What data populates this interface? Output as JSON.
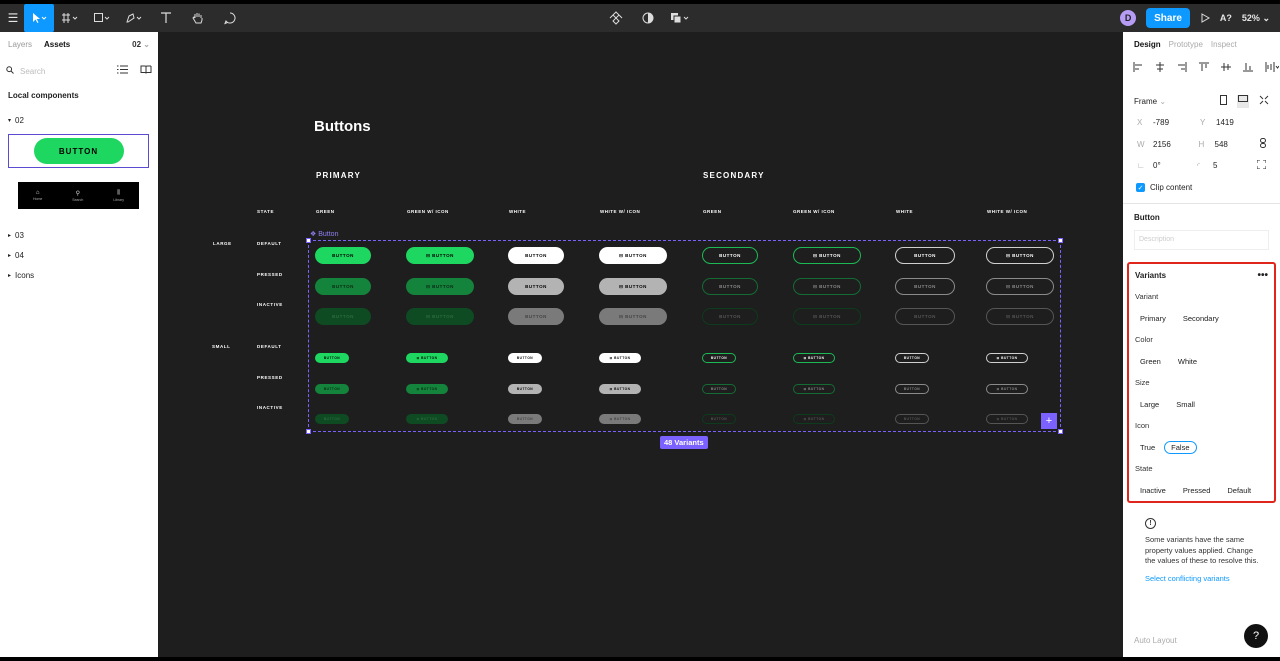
{
  "toolbar": {
    "menu_icon": "☰",
    "share_label": "Share",
    "avatar_letter": "D",
    "a_label": "A?",
    "zoom": "52%"
  },
  "left_panel": {
    "tabs": [
      "Layers",
      "Assets"
    ],
    "page": "02",
    "search_placeholder": "Search",
    "local_components": "Local components",
    "group_02": "02",
    "button_preview_label": "BUTTON",
    "nav_items": [
      "Home",
      "Search",
      "Library"
    ],
    "groups": [
      "03",
      "04",
      "Icons"
    ]
  },
  "canvas": {
    "title": "Buttons",
    "primary_label": "PRIMARY",
    "secondary_label": "SECONDARY",
    "columns": [
      "GREEN",
      "GREEN W/ ICON",
      "WHITE",
      "WHITE W/ ICON",
      "GREEN",
      "GREEN W/ ICON",
      "WHITE",
      "WHITE W/ ICON"
    ],
    "size_labels": [
      "LARGE",
      "SMALL"
    ],
    "state_header": "STATE",
    "states": [
      "DEFAULT",
      "PRESSED",
      "INACTIVE"
    ],
    "component_label": "Button",
    "button_text": "BUTTON",
    "variants_tag": "48 Variants",
    "plus": "+"
  },
  "right_panel": {
    "tabs": [
      "Design",
      "Prototype",
      "Inspect"
    ],
    "frame_label": "Frame",
    "x_label": "X",
    "x": "-789",
    "y_label": "Y",
    "y": "1419",
    "w_label": "W",
    "w": "2156",
    "h_label": "H",
    "h": "548",
    "rotation": "0°",
    "radius": "5",
    "clip_content": "Clip content",
    "component_name": "Button",
    "description_placeholder": "Description",
    "variants": {
      "title": "Variants",
      "props": [
        {
          "name": "Variant",
          "options": [
            "Primary",
            "Secondary"
          ],
          "selected": null
        },
        {
          "name": "Color",
          "options": [
            "Green",
            "White"
          ],
          "selected": null
        },
        {
          "name": "Size",
          "options": [
            "Large",
            "Small"
          ],
          "selected": null
        },
        {
          "name": "Icon",
          "options": [
            "True",
            "False"
          ],
          "selected": "False"
        },
        {
          "name": "State",
          "options": [
            "Inactive",
            "Pressed",
            "Default"
          ],
          "selected": null
        }
      ]
    },
    "warning_text": "Some variants have the same property values applied. Change the values of these to resolve this.",
    "warning_link": "Select conflicting variants",
    "auto_layout": "Auto Layout",
    "help": "?"
  },
  "colors": {
    "accent": "#0d99ff",
    "selection": "#7b61ff",
    "spotify_green": "#1ed760",
    "highlight_box": "#e0261c"
  }
}
